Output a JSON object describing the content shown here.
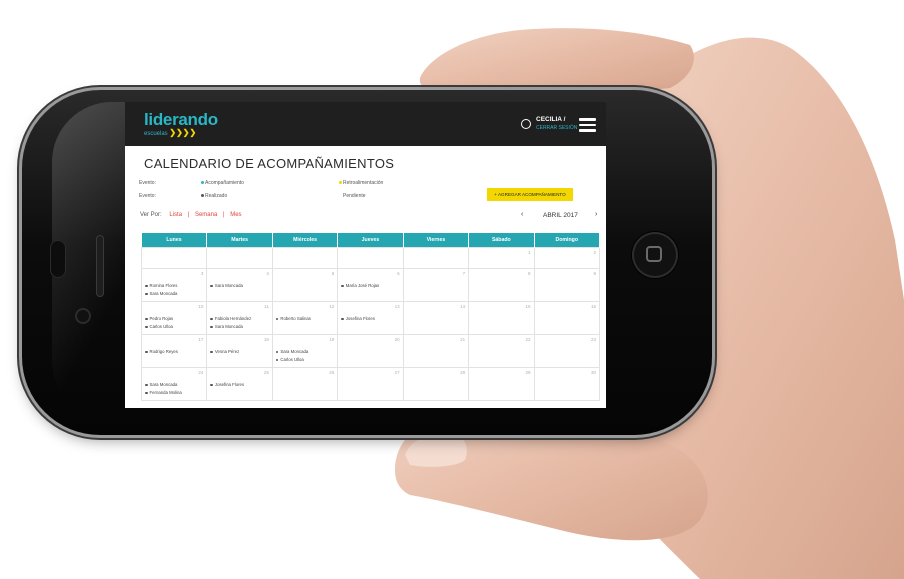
{
  "brand": {
    "name": "liderando",
    "sub": "escuelas",
    "arrows": "❯❯❯❯"
  },
  "user": {
    "name": "CECILIA /",
    "logout": "CERRAR SESIÓN"
  },
  "page_title": "CALENDARIO DE ACOMPAÑAMIENTOS",
  "legend": {
    "row1_label": "Evento:",
    "row2_label": "Evento:",
    "items": [
      {
        "label": "Acompañamiento",
        "color": "#29b7c5"
      },
      {
        "label": "Retroalimentación",
        "color": "#f3d700"
      },
      {
        "label": "Realizado",
        "color": "#555555"
      },
      {
        "label": "Pendiente",
        "color": ""
      }
    ]
  },
  "add_button": "+ AGREGAR ACOMPAÑAMIENTO",
  "view": {
    "label": "Ver Por:",
    "options": [
      "Lista",
      "Semana",
      "Mes"
    ],
    "sep": "|"
  },
  "month": {
    "prev": "‹",
    "label": "ABRIL 2017",
    "next": "›"
  },
  "weekdays": [
    "Lunes",
    "Martes",
    "Miércoles",
    "Jueves",
    "Viernes",
    "Sábado",
    "Domingo"
  ],
  "weeks": [
    [
      {
        "d": ""
      },
      {
        "d": ""
      },
      {
        "d": ""
      },
      {
        "d": ""
      },
      {
        "d": ""
      },
      {
        "d": "1"
      },
      {
        "d": "2"
      }
    ],
    [
      {
        "d": "3",
        "ev": [
          "Romina Flores",
          "Sara Moncada"
        ]
      },
      {
        "d": "4",
        "ev": [
          "Sara Moncada"
        ]
      },
      {
        "d": "5"
      },
      {
        "d": "6",
        "ev": [
          "María José Rojas"
        ]
      },
      {
        "d": "7"
      },
      {
        "d": "8"
      },
      {
        "d": "9"
      }
    ],
    [
      {
        "d": "10",
        "ev": [
          "Pedro Rojas",
          "Carlos Ulloa"
        ]
      },
      {
        "d": "11",
        "ev": [
          "Fabiola Hernández",
          "Sara Moncada"
        ]
      },
      {
        "d": "12",
        "ev": [
          "Roberto Salinas"
        ]
      },
      {
        "d": "13",
        "ev": [
          "Josefina Flores"
        ]
      },
      {
        "d": "14"
      },
      {
        "d": "15"
      },
      {
        "d": "16"
      }
    ],
    [
      {
        "d": "17",
        "ev": [
          "Rodrigo Reyes"
        ]
      },
      {
        "d": "18",
        "ev": [
          "Vesna Pérez"
        ]
      },
      {
        "d": "19",
        "ev": [
          "Sara Moncada",
          "Carlos Ulloa"
        ]
      },
      {
        "d": "20"
      },
      {
        "d": "21"
      },
      {
        "d": "22"
      },
      {
        "d": "23"
      }
    ],
    [
      {
        "d": "24",
        "ev": [
          "Sara Moncada",
          "Fernanda Molina"
        ]
      },
      {
        "d": "25",
        "ev": [
          "Josefina Flores"
        ]
      },
      {
        "d": "26"
      },
      {
        "d": "27"
      },
      {
        "d": "28"
      },
      {
        "d": "29"
      },
      {
        "d": "30"
      }
    ]
  ]
}
